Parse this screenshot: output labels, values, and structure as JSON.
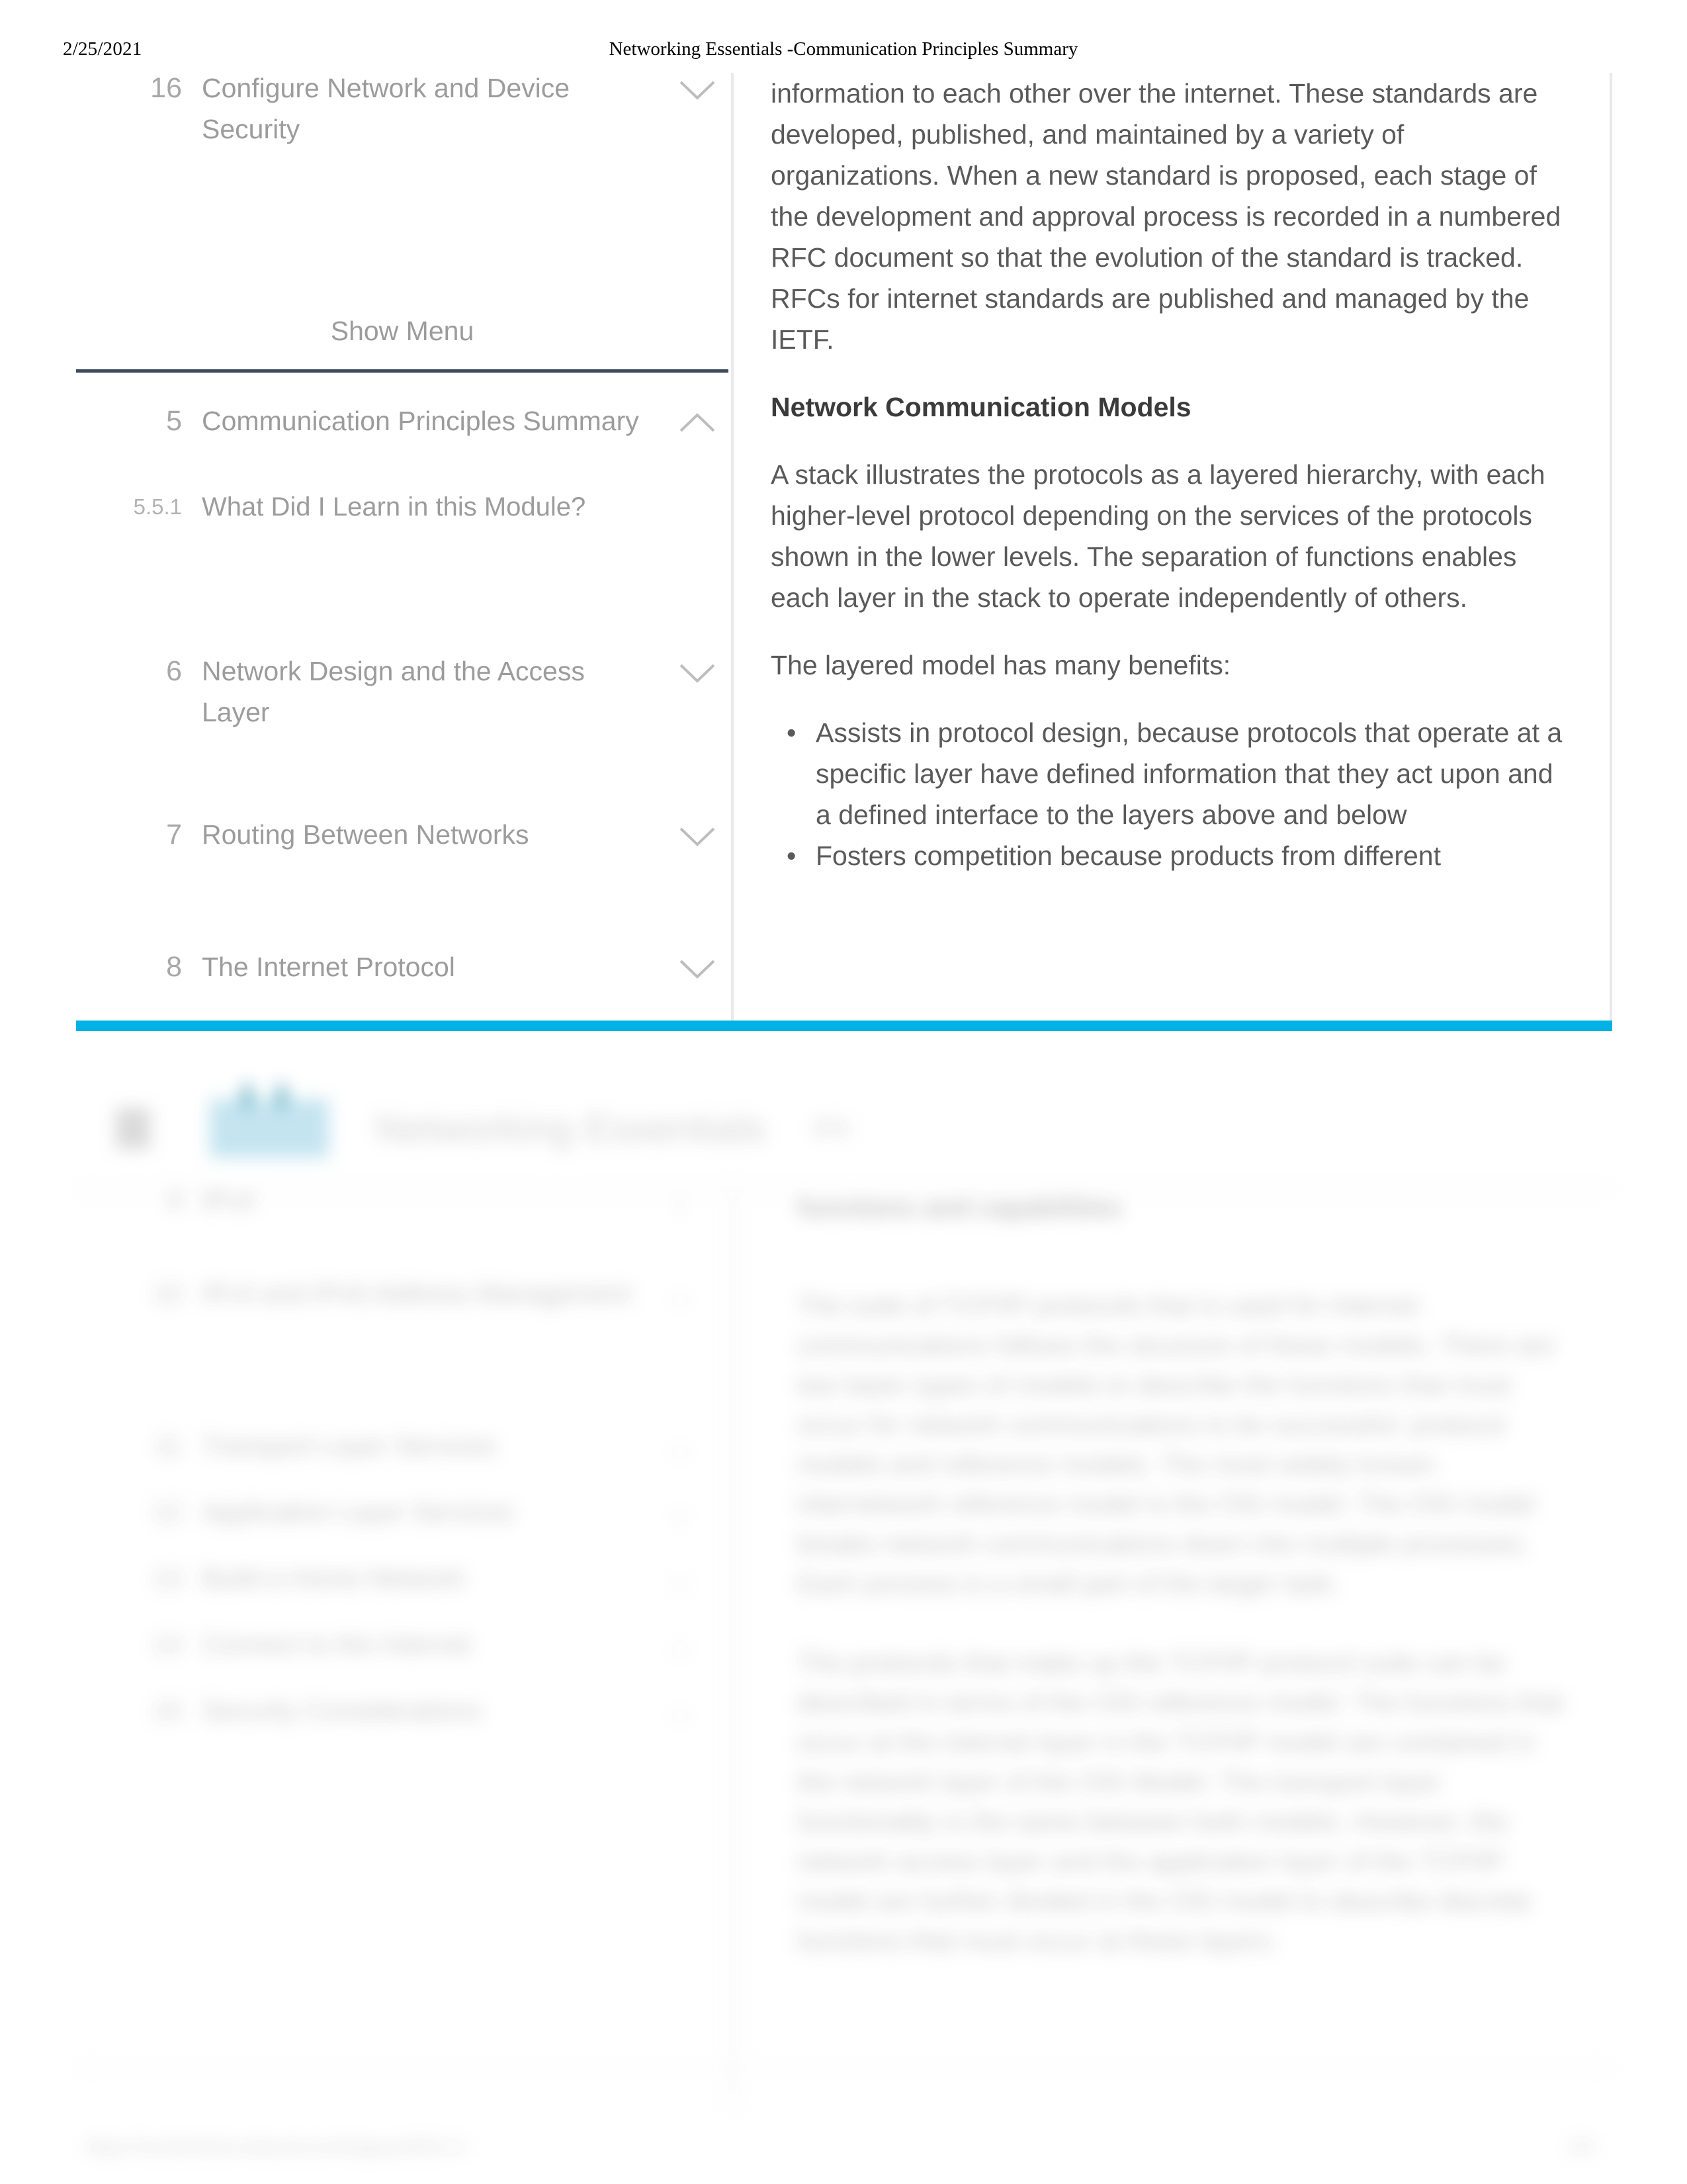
{
  "print_header": {
    "date": "2/25/2021",
    "title": "Networking Essentials -Communication Principles Summary"
  },
  "sidebar": {
    "show_menu_label": "Show Menu",
    "items": [
      {
        "number": "16",
        "label": "Configure Network and Device Security",
        "chevron": "chevron-down"
      },
      {
        "number": "5",
        "label": "Communication Principles Summary",
        "chevron": "chevron-up"
      },
      {
        "number": "5.5.1",
        "label": "What Did I Learn in this Module?",
        "chevron": ""
      },
      {
        "number": "6",
        "label": "Network Design and the Access Layer",
        "chevron": "chevron-down"
      },
      {
        "number": "7",
        "label": "Routing Between Networks",
        "chevron": "chevron-down"
      },
      {
        "number": "8",
        "label": "The Internet Protocol",
        "chevron": "chevron-down"
      }
    ]
  },
  "content": {
    "paragraph_1": "information to each other over the internet. These standards are developed, published, and maintained by a variety of organizations. When a new standard is proposed, each stage of the development and approval process is recorded in a numbered RFC document so that the evolution of the standard is tracked. RFCs for internet standards are published and managed by the IETF.",
    "heading": "Network Communication Models",
    "paragraph_2": "A stack illustrates the protocols as a layered hierarchy, with each higher-level protocol depending on the services of the protocols shown in the lower levels. The separation of functions enables each layer in the stack to operate independently of others.",
    "paragraph_3": "The layered model has many benefits:",
    "bullets": [
      "Assists in protocol design, because protocols that operate at a specific layer have defined information that they act upon and a defined interface to the layers above and below",
      "Fosters competition because products from different"
    ],
    "bullet_glyph": "•"
  },
  "colors": {
    "accent_cyan": "#00b2e3",
    "rule_dark": "#3d4a5c",
    "body_text": "#5a5a5a",
    "muted_text": "#9c9c9c"
  },
  "blurred_page": {
    "brand_title": "Networking Essentials",
    "brand_suffix": "EN",
    "sidebar_items": [
      {
        "number": "9",
        "label": "IPv4"
      },
      {
        "number": "10",
        "label": "IPv4 and IPv6 Address Management"
      },
      {
        "number": "11",
        "label": "Transport Layer Services"
      },
      {
        "number": "12",
        "label": "Application Layer Services"
      },
      {
        "number": "13",
        "label": "Build a Home Network"
      },
      {
        "number": "14",
        "label": "Connect to the Internet"
      },
      {
        "number": "15",
        "label": "Security Considerations"
      }
    ],
    "content_heading": "functions and capabilities",
    "content_paragraphs": [
      "The suite of TCP/IP protocols that is used for internet communications follows the structure of these models. There are two basic types of models to describe the functions that must occur for network communications to be successful: protocol models and reference models. The most widely known internetwork reference model is the OSI model. The OSI model breaks network communications down into multiple processes. Each process is a small part of the larger task.",
      "The protocols that make up the TCP/IP protocol suite can be described in terms of the OSI reference model. The functions that occur at the internet layer in the TCP/IP model are contained in the network layer of the OSI Model. The transport layer functionality is the same between both models. However, the network access layer and the application layer of the TCP/IP model are further divided in the OSI model to describe discrete functions that must occur at these layers."
    ],
    "footer_url": "https://contenthub.netacad.com/legacy/NE/1.0",
    "footer_page": "2/3"
  }
}
